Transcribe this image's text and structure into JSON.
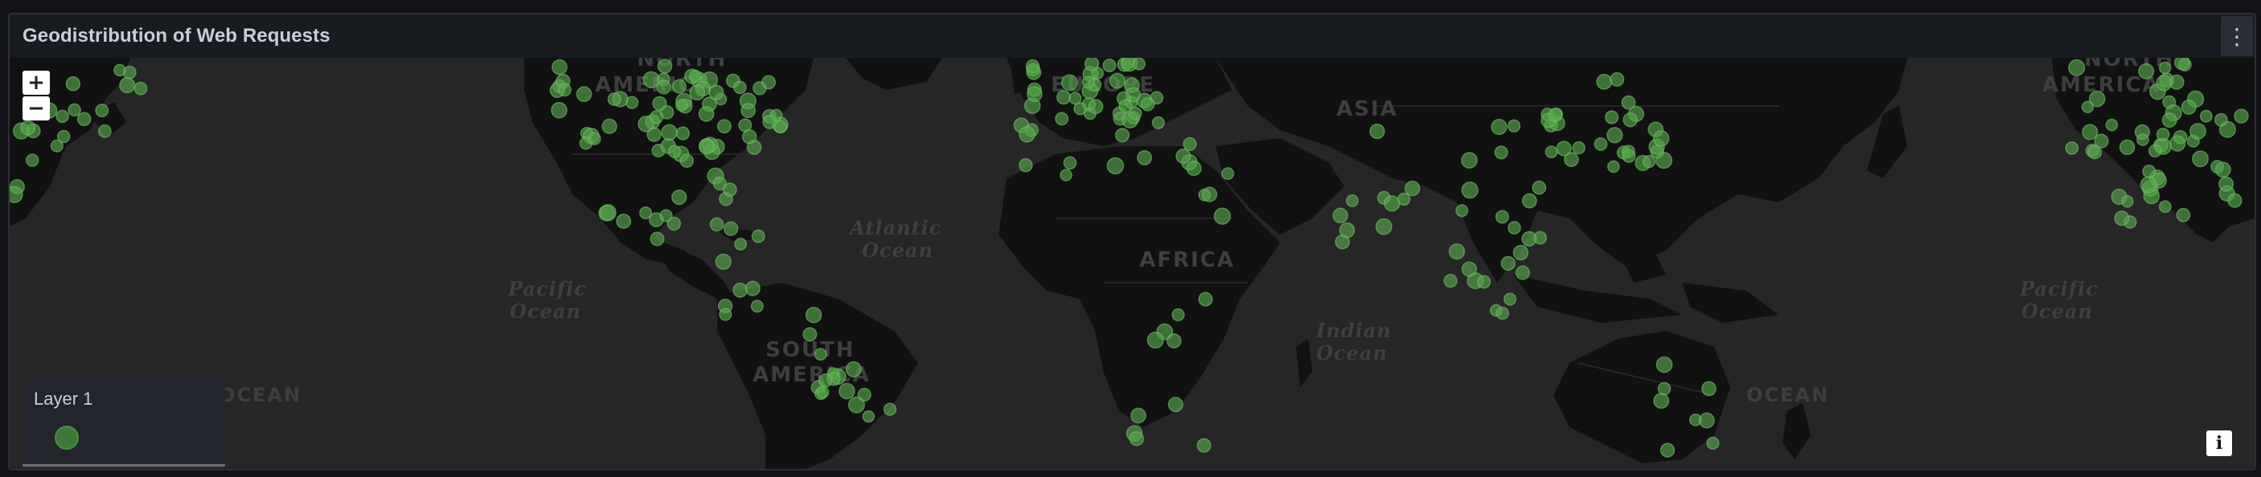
{
  "panel": {
    "title": "Geodistribution of Web Requests",
    "menu_icon": "kebab-vertical-icon"
  },
  "map": {
    "zoom_in_label": "+",
    "zoom_out_label": "−",
    "info_label": "i",
    "labels": {
      "north_america_left": "NORTH",
      "north_america_left_2": "AMERICA",
      "north_america_right": "NORTH",
      "north_america_right_2": "AMERICA",
      "europe": "EUROPE",
      "asia": "ASIA",
      "africa": "AFRICA",
      "south_america": "SOUTH",
      "south_america_2": "AMERICA",
      "atlantic": "Atlantic",
      "atlantic_2": "Ocean",
      "pacific_left": "Pacific",
      "pacific_left_2": "Ocean",
      "pacific_right": "Pacific",
      "pacific_right_2": "Ocean",
      "indian": "Indian",
      "indian_2": "Ocean",
      "ocean_left": "OCEAN",
      "ocean_right": "OCEAN"
    }
  },
  "legend": {
    "layer_name": "Layer 1",
    "marker_color": "#3d7a3a"
  },
  "colors": {
    "marker_fill": "#56a64b",
    "marker_stroke": "#73bf69",
    "land": "#111111",
    "water": "#262626"
  }
}
